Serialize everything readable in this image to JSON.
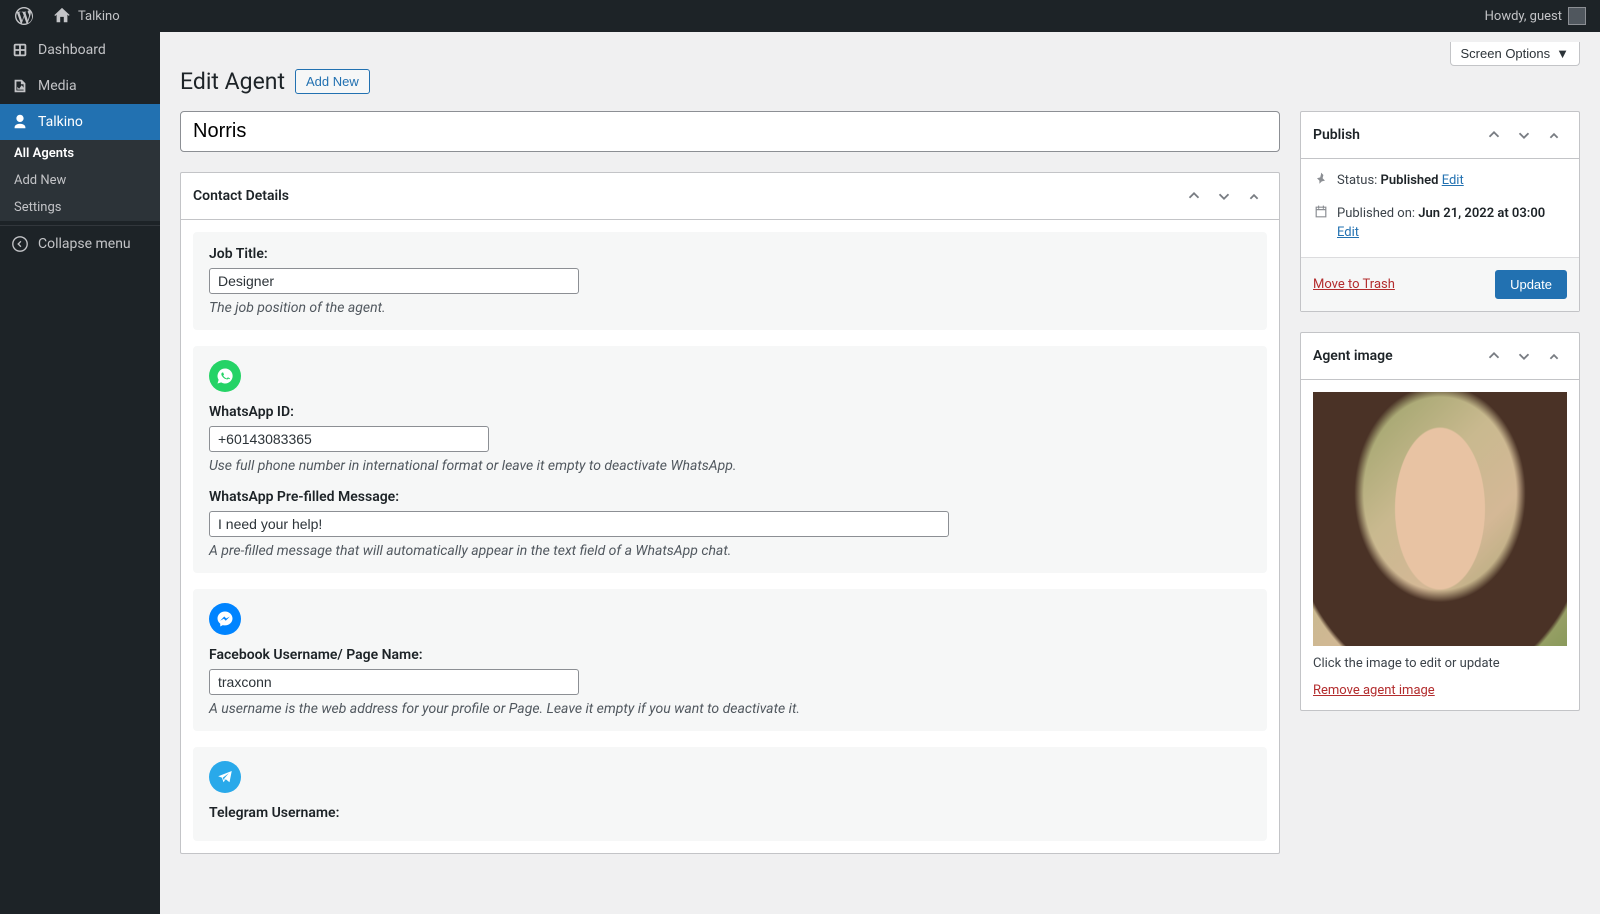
{
  "adminbar": {
    "site_name": "Talkino",
    "howdy": "Howdy, guest"
  },
  "sidebar": {
    "dashboard": "Dashboard",
    "media": "Media",
    "talkino": "Talkino",
    "sub_all": "All Agents",
    "sub_add": "Add New",
    "sub_settings": "Settings",
    "collapse": "Collapse menu"
  },
  "screen_options": "Screen Options",
  "page_title": "Edit Agent",
  "add_new": "Add New",
  "title_value": "Norris",
  "contact_box": {
    "title": "Contact Details",
    "job_label": "Job Title:",
    "job_value": "Designer",
    "job_help": "The job position of the agent.",
    "wa_id_label": "WhatsApp ID:",
    "wa_id_value": "+60143083365",
    "wa_id_help": "Use full phone number in international format or leave it empty to deactivate WhatsApp.",
    "wa_msg_label": "WhatsApp Pre-filled Message:",
    "wa_msg_value": "I need your help!",
    "wa_msg_help": "A pre-filled message that will automatically appear in the text field of a WhatsApp chat.",
    "fb_label": "Facebook Username/ Page Name:",
    "fb_value": "traxconn",
    "fb_help": "A username is the web address for your profile or Page. Leave it empty if you want to deactivate it.",
    "tg_label": "Telegram Username:"
  },
  "publish": {
    "title": "Publish",
    "status_label": "Status: ",
    "status_value": "Published",
    "status_edit": "Edit",
    "published_label": "Published on: ",
    "published_value": "Jun 21, 2022 at 03:00",
    "published_edit": "Edit",
    "trash": "Move to Trash",
    "update": "Update"
  },
  "agent_image": {
    "title": "Agent image",
    "help": "Click the image to edit or update",
    "remove": "Remove agent image"
  }
}
